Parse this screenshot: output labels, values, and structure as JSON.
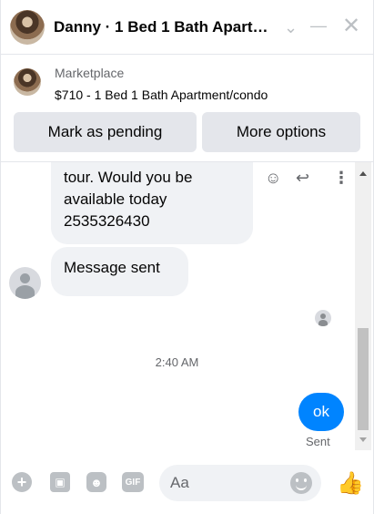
{
  "header": {
    "title": "Danny · 1 Bed 1 Bath Apart…",
    "icons": {
      "chevron": "chevron-down-icon",
      "minimize": "minimize-icon",
      "close": "close-icon"
    }
  },
  "marketplace": {
    "label": "Marketplace",
    "listing": "$710 - 1 Bed 1 Bath Apartment/condo",
    "buttons": {
      "pending": "Mark as pending",
      "more": "More options"
    }
  },
  "messages": {
    "incoming": [
      {
        "text": "tour. Would you be available today 2535326430"
      },
      {
        "text": "Message sent"
      }
    ],
    "timestamp": "2:40 AM",
    "outgoing": {
      "text": "ok",
      "status": "Sent"
    }
  },
  "composer": {
    "placeholder": "Aa",
    "icons": [
      "plus-icon",
      "photo-icon",
      "sticker-icon",
      "gif-icon",
      "emoji-icon",
      "like-icon"
    ]
  },
  "colors": {
    "accent": "#0084ff",
    "bubble_in": "#f0f2f5",
    "icon_gray": "#bcc0c4"
  }
}
